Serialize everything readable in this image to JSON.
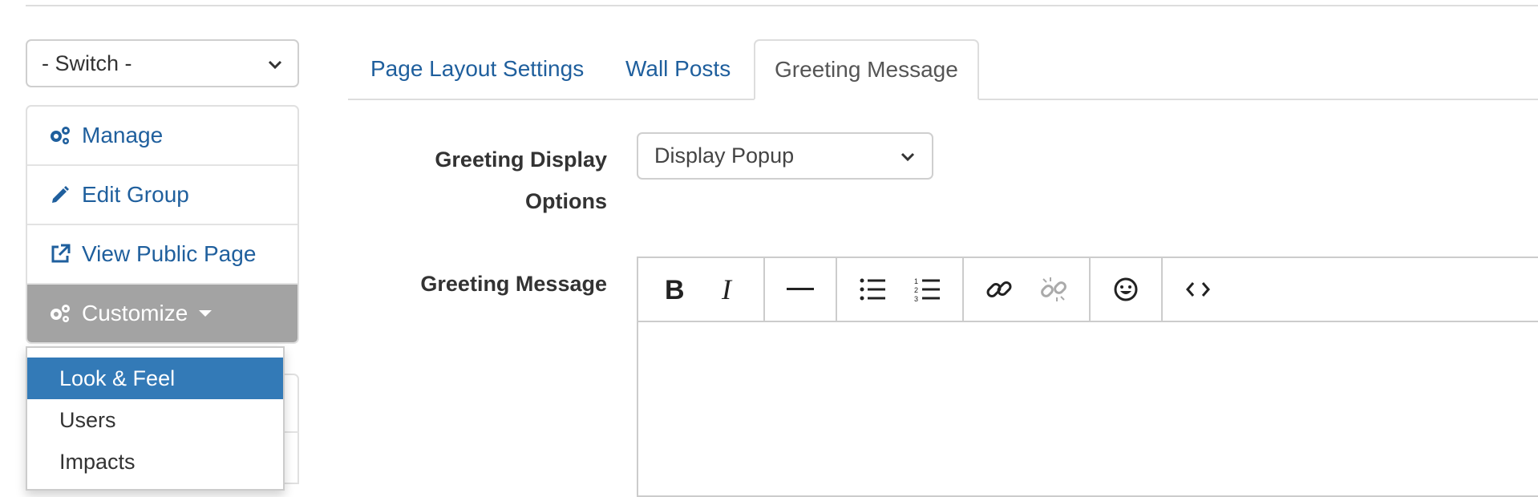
{
  "sidebar": {
    "switch_value": "- Switch -",
    "items": [
      {
        "label": "Manage",
        "icon": "gears-icon"
      },
      {
        "label": "Edit Group",
        "icon": "pencil-icon"
      },
      {
        "label": "View Public Page",
        "icon": "external-link-icon"
      },
      {
        "label": "Customize",
        "icon": "gears-icon",
        "active": true
      }
    ],
    "dropdown": [
      "Look & Feel",
      "Users",
      "Impacts"
    ]
  },
  "tabs": [
    {
      "label": "Page Layout Settings",
      "active": false
    },
    {
      "label": "Wall Posts",
      "active": false
    },
    {
      "label": "Greeting Message",
      "active": true
    }
  ],
  "form": {
    "display_label_line1": "Greeting Display",
    "display_label_line2": "Options",
    "display_value": "Display Popup",
    "message_label": "Greeting Message"
  },
  "toolbar_icons": [
    "bold-icon",
    "italic-icon",
    "horizontal-rule-icon",
    "bullet-list-icon",
    "numbered-list-icon",
    "link-icon",
    "unlink-icon",
    "emoji-icon",
    "code-icon"
  ],
  "colors": {
    "link": "#1f5f9d",
    "active_sidebar": "#a3a3a3",
    "highlight": "#337ab7"
  }
}
